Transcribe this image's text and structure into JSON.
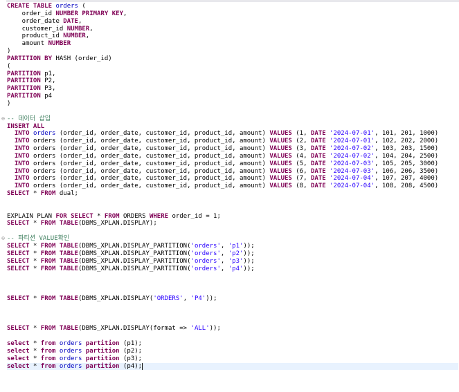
{
  "lines": [
    [
      {
        "t": "CREATE TABLE ",
        "c": "kw"
      },
      {
        "t": "orders",
        "c": "tbl"
      },
      {
        "t": " (",
        "c": "plain"
      }
    ],
    [
      {
        "t": "    order_id ",
        "c": "plain"
      },
      {
        "t": "NUMBER PRIMARY KEY",
        "c": "kw"
      },
      {
        "t": ",",
        "c": "plain"
      }
    ],
    [
      {
        "t": "    order_date ",
        "c": "plain"
      },
      {
        "t": "DATE",
        "c": "kw"
      },
      {
        "t": ",",
        "c": "plain"
      }
    ],
    [
      {
        "t": "    customer_id ",
        "c": "plain"
      },
      {
        "t": "NUMBER",
        "c": "kw"
      },
      {
        "t": ",",
        "c": "plain"
      }
    ],
    [
      {
        "t": "    product_id ",
        "c": "plain"
      },
      {
        "t": "NUMBER",
        "c": "kw"
      },
      {
        "t": ",",
        "c": "plain"
      }
    ],
    [
      {
        "t": "    amount ",
        "c": "plain"
      },
      {
        "t": "NUMBER",
        "c": "kw"
      }
    ],
    [
      {
        "t": ")",
        "c": "plain"
      }
    ],
    [
      {
        "t": "PARTITION BY ",
        "c": "kw"
      },
      {
        "t": "HASH (order_id)",
        "c": "plain"
      }
    ],
    [
      {
        "t": "(",
        "c": "plain"
      }
    ],
    [
      {
        "t": "PARTITION ",
        "c": "kw"
      },
      {
        "t": "p1,",
        "c": "plain"
      }
    ],
    [
      {
        "t": "PARTITION ",
        "c": "kw"
      },
      {
        "t": "P2,",
        "c": "plain"
      }
    ],
    [
      {
        "t": "PARTITION ",
        "c": "kw"
      },
      {
        "t": "P3,",
        "c": "plain"
      }
    ],
    [
      {
        "t": "PARTITION ",
        "c": "kw"
      },
      {
        "t": "p4",
        "c": "plain"
      }
    ],
    [
      {
        "t": ")",
        "c": "plain"
      }
    ],
    [],
    [
      {
        "t": "-- 데이터 삽입",
        "c": "cmt"
      }
    ],
    [
      {
        "t": "INSERT ALL",
        "c": "kw"
      }
    ],
    [
      {
        "t": "  INTO ",
        "c": "kw"
      },
      {
        "t": "orders",
        "c": "tbl"
      },
      {
        "t": " (order_id, order_date, customer_id, product_id, amount) ",
        "c": "plain"
      },
      {
        "t": "VALUES ",
        "c": "kw"
      },
      {
        "t": "(1, ",
        "c": "plain"
      },
      {
        "t": "DATE ",
        "c": "kw"
      },
      {
        "t": "'2024-07-01'",
        "c": "str"
      },
      {
        "t": ", 101, 201, 1000)",
        "c": "plain"
      }
    ],
    [
      {
        "t": "  INTO ",
        "c": "kw"
      },
      {
        "t": "orders (order_id, order_date, customer_id, product_id, amount) ",
        "c": "plain"
      },
      {
        "t": "VALUES ",
        "c": "kw"
      },
      {
        "t": "(2, ",
        "c": "plain"
      },
      {
        "t": "DATE ",
        "c": "kw"
      },
      {
        "t": "'2024-07-01'",
        "c": "str"
      },
      {
        "t": ", 102, 202, 2000)",
        "c": "plain"
      }
    ],
    [
      {
        "t": "  INTO ",
        "c": "kw"
      },
      {
        "t": "orders (order_id, order_date, customer_id, product_id, amount) ",
        "c": "plain"
      },
      {
        "t": "VALUES ",
        "c": "kw"
      },
      {
        "t": "(3, ",
        "c": "plain"
      },
      {
        "t": "DATE ",
        "c": "kw"
      },
      {
        "t": "'2024-07-02'",
        "c": "str"
      },
      {
        "t": ", 103, 203, 1500)",
        "c": "plain"
      }
    ],
    [
      {
        "t": "  INTO ",
        "c": "kw"
      },
      {
        "t": "orders (order_id, order_date, customer_id, product_id, amount) ",
        "c": "plain"
      },
      {
        "t": "VALUES ",
        "c": "kw"
      },
      {
        "t": "(4, ",
        "c": "plain"
      },
      {
        "t": "DATE ",
        "c": "kw"
      },
      {
        "t": "'2024-07-02'",
        "c": "str"
      },
      {
        "t": ", 104, 204, 2500)",
        "c": "plain"
      }
    ],
    [
      {
        "t": "  INTO ",
        "c": "kw"
      },
      {
        "t": "orders (order_id, order_date, customer_id, product_id, amount) ",
        "c": "plain"
      },
      {
        "t": "VALUES ",
        "c": "kw"
      },
      {
        "t": "(5, ",
        "c": "plain"
      },
      {
        "t": "DATE ",
        "c": "kw"
      },
      {
        "t": "'2024-07-03'",
        "c": "str"
      },
      {
        "t": ", 105, 205, 3000)",
        "c": "plain"
      }
    ],
    [
      {
        "t": "  INTO ",
        "c": "kw"
      },
      {
        "t": "orders (order_id, order_date, customer_id, product_id, amount) ",
        "c": "plain"
      },
      {
        "t": "VALUES ",
        "c": "kw"
      },
      {
        "t": "(6, ",
        "c": "plain"
      },
      {
        "t": "DATE ",
        "c": "kw"
      },
      {
        "t": "'2024-07-03'",
        "c": "str"
      },
      {
        "t": ", 106, 206, 3500)",
        "c": "plain"
      }
    ],
    [
      {
        "t": "  INTO ",
        "c": "kw"
      },
      {
        "t": "orders (order_id, order_date, customer_id, product_id, amount) ",
        "c": "plain"
      },
      {
        "t": "VALUES ",
        "c": "kw"
      },
      {
        "t": "(7, ",
        "c": "plain"
      },
      {
        "t": "DATE ",
        "c": "kw"
      },
      {
        "t": "'2024-07-04'",
        "c": "str"
      },
      {
        "t": ", 107, 207, 4000)",
        "c": "plain"
      }
    ],
    [
      {
        "t": "  INTO ",
        "c": "kw"
      },
      {
        "t": "orders (order_id, order_date, customer_id, product_id, amount) ",
        "c": "plain"
      },
      {
        "t": "VALUES ",
        "c": "kw"
      },
      {
        "t": "(8, ",
        "c": "plain"
      },
      {
        "t": "DATE ",
        "c": "kw"
      },
      {
        "t": "'2024-07-04'",
        "c": "str"
      },
      {
        "t": ", 108, 208, 4500)",
        "c": "plain"
      }
    ],
    [
      {
        "t": "SELECT ",
        "c": "kw"
      },
      {
        "t": "* ",
        "c": "plain"
      },
      {
        "t": "FROM ",
        "c": "kw"
      },
      {
        "t": "dual;",
        "c": "plain"
      }
    ],
    [],
    [],
    [
      {
        "t": "EXPLAIN PLAN ",
        "c": "plain"
      },
      {
        "t": "FOR SELECT ",
        "c": "kw"
      },
      {
        "t": "* ",
        "c": "plain"
      },
      {
        "t": "FROM ",
        "c": "kw"
      },
      {
        "t": "ORDERS ",
        "c": "plain"
      },
      {
        "t": "WHERE ",
        "c": "kw"
      },
      {
        "t": "order_id = 1;",
        "c": "plain"
      }
    ],
    [
      {
        "t": "SELECT ",
        "c": "kw"
      },
      {
        "t": "* ",
        "c": "plain"
      },
      {
        "t": "FROM ",
        "c": "kw"
      },
      {
        "t": "TABLE",
        "c": "kw"
      },
      {
        "t": "(DBMS_XPLAN.DISPLAY);",
        "c": "plain"
      }
    ],
    [],
    [
      {
        "t": "-- 파티션 VALUE확인",
        "c": "cmt"
      }
    ],
    [
      {
        "t": "SELECT ",
        "c": "kw"
      },
      {
        "t": "* ",
        "c": "plain"
      },
      {
        "t": "FROM ",
        "c": "kw"
      },
      {
        "t": "TABLE",
        "c": "kw"
      },
      {
        "t": "(DBMS_XPLAN.DISPLAY_PARTITION(",
        "c": "plain"
      },
      {
        "t": "'orders'",
        "c": "str"
      },
      {
        "t": ", ",
        "c": "plain"
      },
      {
        "t": "'p1'",
        "c": "str"
      },
      {
        "t": "));",
        "c": "plain"
      }
    ],
    [
      {
        "t": "SELECT ",
        "c": "kw"
      },
      {
        "t": "* ",
        "c": "plain"
      },
      {
        "t": "FROM ",
        "c": "kw"
      },
      {
        "t": "TABLE",
        "c": "kw"
      },
      {
        "t": "(DBMS_XPLAN.DISPLAY_PARTITION(",
        "c": "plain"
      },
      {
        "t": "'orders'",
        "c": "str"
      },
      {
        "t": ", ",
        "c": "plain"
      },
      {
        "t": "'p2'",
        "c": "str"
      },
      {
        "t": "));",
        "c": "plain"
      }
    ],
    [
      {
        "t": "SELECT ",
        "c": "kw"
      },
      {
        "t": "* ",
        "c": "plain"
      },
      {
        "t": "FROM ",
        "c": "kw"
      },
      {
        "t": "TABLE",
        "c": "kw"
      },
      {
        "t": "(DBMS_XPLAN.DISPLAY_PARTITION(",
        "c": "plain"
      },
      {
        "t": "'orders'",
        "c": "str"
      },
      {
        "t": ", ",
        "c": "plain"
      },
      {
        "t": "'p3'",
        "c": "str"
      },
      {
        "t": "));",
        "c": "plain"
      }
    ],
    [
      {
        "t": "SELECT ",
        "c": "kw"
      },
      {
        "t": "* ",
        "c": "plain"
      },
      {
        "t": "FROM ",
        "c": "kw"
      },
      {
        "t": "TABLE",
        "c": "kw"
      },
      {
        "t": "(DBMS_XPLAN.DISPLAY_PARTITION(",
        "c": "plain"
      },
      {
        "t": "'orders'",
        "c": "str"
      },
      {
        "t": ", ",
        "c": "plain"
      },
      {
        "t": "'p4'",
        "c": "str"
      },
      {
        "t": "));",
        "c": "plain"
      }
    ],
    [],
    [],
    [],
    [
      {
        "t": "SELECT ",
        "c": "kw"
      },
      {
        "t": "* ",
        "c": "plain"
      },
      {
        "t": "FROM ",
        "c": "kw"
      },
      {
        "t": "TABLE",
        "c": "kw"
      },
      {
        "t": "(DBMS_XPLAN.DISPLAY(",
        "c": "plain"
      },
      {
        "t": "'ORDERS'",
        "c": "str"
      },
      {
        "t": ", ",
        "c": "plain"
      },
      {
        "t": "'P4'",
        "c": "str"
      },
      {
        "t": "));",
        "c": "plain"
      }
    ],
    [],
    [],
    [],
    [
      {
        "t": "SELECT ",
        "c": "kw"
      },
      {
        "t": "* ",
        "c": "plain"
      },
      {
        "t": "FROM ",
        "c": "kw"
      },
      {
        "t": "TABLE",
        "c": "kw"
      },
      {
        "t": "(DBMS_XPLAN.DISPLAY(format => ",
        "c": "plain"
      },
      {
        "t": "'ALL'",
        "c": "str"
      },
      {
        "t": "));",
        "c": "plain"
      }
    ],
    [],
    [
      {
        "t": "select ",
        "c": "kw"
      },
      {
        "t": "* ",
        "c": "plain"
      },
      {
        "t": "from ",
        "c": "kw"
      },
      {
        "t": "orders ",
        "c": "tbl"
      },
      {
        "t": "partition ",
        "c": "kw"
      },
      {
        "t": "(p1);",
        "c": "plain"
      }
    ],
    [
      {
        "t": "select ",
        "c": "kw"
      },
      {
        "t": "* ",
        "c": "plain"
      },
      {
        "t": "from ",
        "c": "kw"
      },
      {
        "t": "orders ",
        "c": "tbl"
      },
      {
        "t": "partition ",
        "c": "kw"
      },
      {
        "t": "(p2);",
        "c": "plain"
      }
    ],
    [
      {
        "t": "select ",
        "c": "kw"
      },
      {
        "t": "* ",
        "c": "plain"
      },
      {
        "t": "from ",
        "c": "kw"
      },
      {
        "t": "orders ",
        "c": "tbl"
      },
      {
        "t": "partition ",
        "c": "kw"
      },
      {
        "t": "(p3);",
        "c": "plain"
      }
    ],
    [
      {
        "t": "select ",
        "c": "kw"
      },
      {
        "t": "* ",
        "c": "plain"
      },
      {
        "t": "from ",
        "c": "kw"
      },
      {
        "t": "orders ",
        "c": "tbl"
      },
      {
        "t": "partition ",
        "c": "kw"
      },
      {
        "t": "(p4);",
        "c": "plain"
      }
    ]
  ],
  "fold_markers": [
    {
      "line": 15,
      "symbol": "⊖"
    },
    {
      "line": 31,
      "symbol": "⊖"
    }
  ],
  "current_line": 48,
  "colors": {
    "keyword": "#7f0055",
    "string": "#2a00ff",
    "comment": "#3f7f5f",
    "table_identifier": "#0000c0",
    "current_line_bg": "#e8f2fe"
  }
}
